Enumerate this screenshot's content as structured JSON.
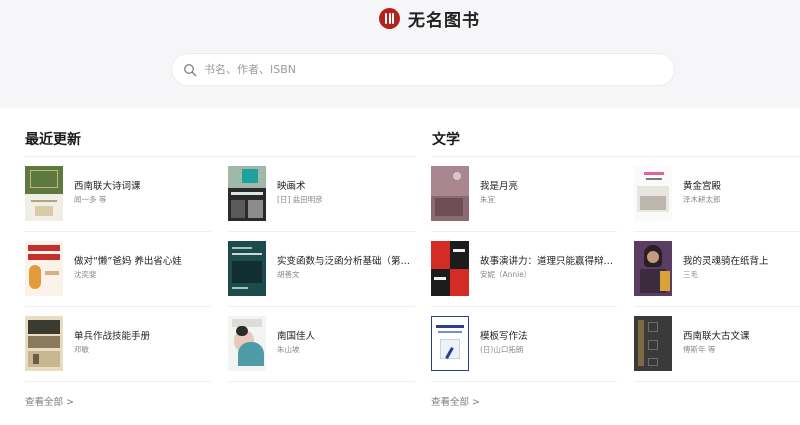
{
  "brand": {
    "name": "无名图书",
    "logo_color": "#b3231d"
  },
  "search": {
    "placeholder": "书名、作者、ISBN"
  },
  "sections": [
    {
      "title": "最近更新",
      "view_all": "查看全部 >",
      "books": [
        {
          "title": "西南联大诗词课",
          "author": "闻一多 等",
          "cover": "green-gilt"
        },
        {
          "title": "映画术",
          "author": "[日] 盐田明彦",
          "cover": "teal-film"
        },
        {
          "title": "做对“懒”爸妈 养出省心娃",
          "author": "沈奕斐",
          "cover": "red-parenting"
        },
        {
          "title": "实变函数与泛函分析基础（第…",
          "author": "胡善文",
          "cover": "dark-teal-math"
        },
        {
          "title": "单兵作战技能手册",
          "author": "邓敏",
          "cover": "military-beige"
        },
        {
          "title": "南国佳人",
          "author": "朱山坡",
          "cover": "illustrated-woman"
        }
      ]
    },
    {
      "title": "文学",
      "view_all": "查看全部 >",
      "books": [
        {
          "title": "我是月亮",
          "author": "朱宜",
          "cover": "mauve-moon"
        },
        {
          "title": "黄金宫殿",
          "author": "泽木耕太郎",
          "cover": "white-palace"
        },
        {
          "title": "故事演讲力：道理只能赢得辩…",
          "author": "安妮（Annie）",
          "cover": "red-black-speech"
        },
        {
          "title": "我的灵魂骑在纸背上",
          "author": "三毛",
          "cover": "purple-portrait"
        },
        {
          "title": "模板写作法",
          "author": "(日)山口拓朗",
          "cover": "white-blue-frame"
        },
        {
          "title": "西南联大古文课",
          "author": "傅斯年 等",
          "cover": "dark-calligraphy"
        }
      ]
    }
  ]
}
